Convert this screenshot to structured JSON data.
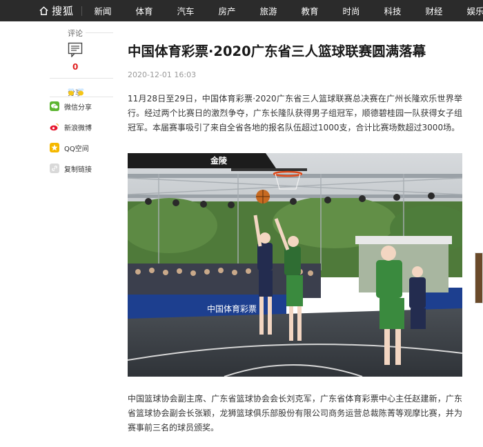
{
  "topbar": {
    "logo_text": "搜狐",
    "nav": [
      "新闻",
      "体育",
      "汽车",
      "房产",
      "旅游",
      "教育",
      "时尚",
      "科技",
      "财经",
      "娱乐"
    ]
  },
  "rail": {
    "comment_label": "评论",
    "comment_count": "0",
    "share_label": "分享",
    "share_items": [
      {
        "label": "微信分享",
        "color": "#5cb531"
      },
      {
        "label": "新浪微博",
        "color": "#e6162d"
      },
      {
        "label": "QQ空间",
        "color": "#f5b800"
      },
      {
        "label": "复制链接",
        "color": "#bdbdbd"
      }
    ]
  },
  "article": {
    "title": "中国体育彩票·2020广东省三人篮球联赛圆满落幕",
    "date": "2020-12-01 16:03",
    "paragraph1": "11月28日至29日，中国体育彩票·2020广东省三人篮球联赛总决赛在广州长隆欢乐世界举行。经过两个比赛日的激烈争夺，广东长隆队获得男子组冠军，顺德碧桂园一队获得女子组冠军。本届赛事吸引了来自全省各地的报名队伍超过1000支，合计比赛场数超过3000场。",
    "photo_banner_left": "金陵",
    "photo_banner_ads": "中国体育彩票",
    "paragraph2": "中国篮球协会副主席、广东省篮球协会会长刘克军，广东省体育彩票中心主任赵建新，广东省篮球协会副会长张颖，龙狮篮球俱乐部股份有限公司商务运营总裁陈菁等观摩比赛，并为赛事前三名的球员颁奖。"
  },
  "colors": {
    "topbar_bg": "#2b2b2b",
    "accent_red": "#e02020"
  }
}
